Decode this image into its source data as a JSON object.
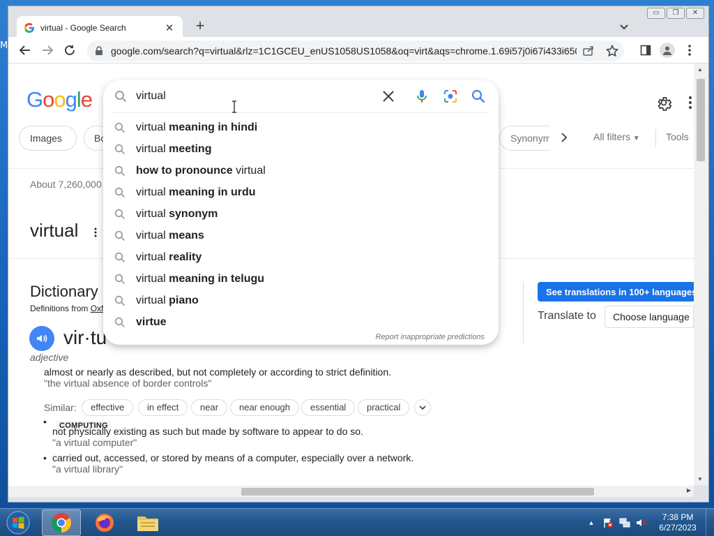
{
  "desktop": {
    "edge_letter": "M"
  },
  "browser": {
    "tab_title": "virtual - Google Search",
    "url": "google.com/search?q=virtual&rlz=1C1GCEU_enUS1058US1058&oq=virt&aqs=chrome.1.69i57j0i67i433i650...",
    "window_controls": {
      "minimize": "▭",
      "restore": "❐",
      "close": "✕"
    }
  },
  "google": {
    "logo_letters": [
      "G",
      "o",
      "o",
      "g",
      "l",
      "e"
    ],
    "logo_colors": [
      "#4285f4",
      "#ea4335",
      "#fbbc05",
      "#4285f4",
      "#34a853",
      "#ea4335"
    ],
    "chips": [
      "Images",
      "Bo",
      "Synonym"
    ],
    "all_filters": "All filters",
    "tools": "Tools",
    "results_count": "About 7,260,000",
    "word": "virtual"
  },
  "search": {
    "query": "virtual",
    "suggestions": [
      {
        "plain": "virtual ",
        "bold": "meaning in hindi",
        "prefix": ""
      },
      {
        "plain": "virtual ",
        "bold": "meeting",
        "prefix": ""
      },
      {
        "prefix": "how to pronounce",
        "plain": " virtual",
        "bold": ""
      },
      {
        "plain": "virtual ",
        "bold": "meaning in urdu",
        "prefix": ""
      },
      {
        "plain": "virtual ",
        "bold": "synonym",
        "prefix": ""
      },
      {
        "plain": "virtual ",
        "bold": "means",
        "prefix": ""
      },
      {
        "plain": "virtual ",
        "bold": "reality",
        "prefix": ""
      },
      {
        "plain": "virtual ",
        "bold": "meaning in telugu",
        "prefix": ""
      },
      {
        "plain": "virtual ",
        "bold": "piano",
        "prefix": ""
      },
      {
        "plain": "",
        "bold": "virtue",
        "prefix": ""
      }
    ],
    "report": "Report inappropriate predictions"
  },
  "dictionary": {
    "title": "Dictionary",
    "from_prefix": "Definitions from ",
    "from_source": "Oxf",
    "phonetic": "vir·tu",
    "pos": "adjective",
    "def1": "almost or nearly as described, but not completely or according to strict definition.",
    "ex1": "\"the virtual absence of border controls\"",
    "similar_label": "Similar:",
    "similar": [
      "effective",
      "in effect",
      "near",
      "near enough",
      "essential",
      "practical"
    ],
    "tag": "COMPUTING",
    "def2": "not physically existing as such but made by software to appear to do so.",
    "ex2": "\"a virtual computer\"",
    "def3": "carried out, accessed, or stored by means of a computer, especially over a network.",
    "ex3": "\"a virtual library\""
  },
  "translate": {
    "button": "See translations in 100+ languages",
    "label": "Translate to",
    "choose": "Choose language"
  },
  "taskbar": {
    "time": "7:38 PM",
    "date": "6/27/2023"
  }
}
